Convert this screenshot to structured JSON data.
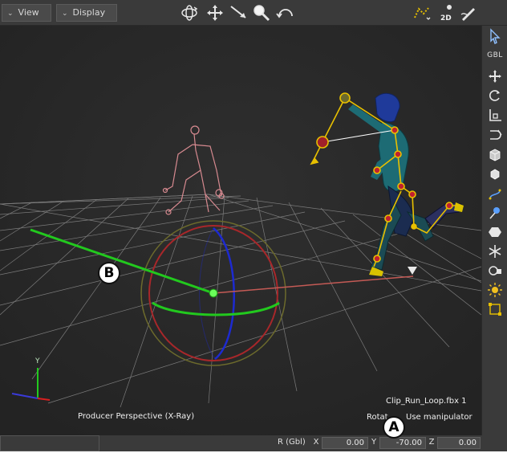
{
  "menu": {
    "view_label": "View",
    "display_label": "Display"
  },
  "toolbar": {
    "center_tools": [
      "orbit-icon",
      "pan-icon",
      "dolly-icon",
      "zoom-icon",
      "undo-view-icon"
    ],
    "right_tools": [
      "skeleton-display-icon",
      "2d-display-icon",
      "edit-pen-icon"
    ],
    "two_d_label": "2D"
  },
  "right_toolbar": {
    "gbl_label": "GBL",
    "tools": [
      "select-arrow-icon",
      "gbl-icon",
      "translate-icon",
      "rotate-icon",
      "scale-icon",
      "magnet-icon",
      "cube-icon",
      "cube-small-icon",
      "path-icon",
      "pin-icon",
      "hexagon-icon",
      "asterisk-icon",
      "camera-icon",
      "light-icon",
      "frame-icon"
    ]
  },
  "viewport": {
    "camera_label": "Producer Perspective (X-Ray)",
    "clip_label": "Clip_Run_Loop.fbx 1",
    "mode_label_prefix": "Rotat",
    "mode_label_suffix": "Use manipulator",
    "axis_y_label": "Y"
  },
  "callouts": {
    "a": "A",
    "b": "B"
  },
  "status": {
    "r_label": "R (Gbl)",
    "x_label": "X",
    "x_value": "0.00",
    "y_label": "Y",
    "y_value": "-70.00",
    "z_label": "Z",
    "z_value": "0.00"
  },
  "colors": {
    "accent_yellow": "#e8c000",
    "manipulator_green": "#22c91e",
    "manipulator_red": "#c0282a",
    "manipulator_blue": "#1d2ad0"
  }
}
